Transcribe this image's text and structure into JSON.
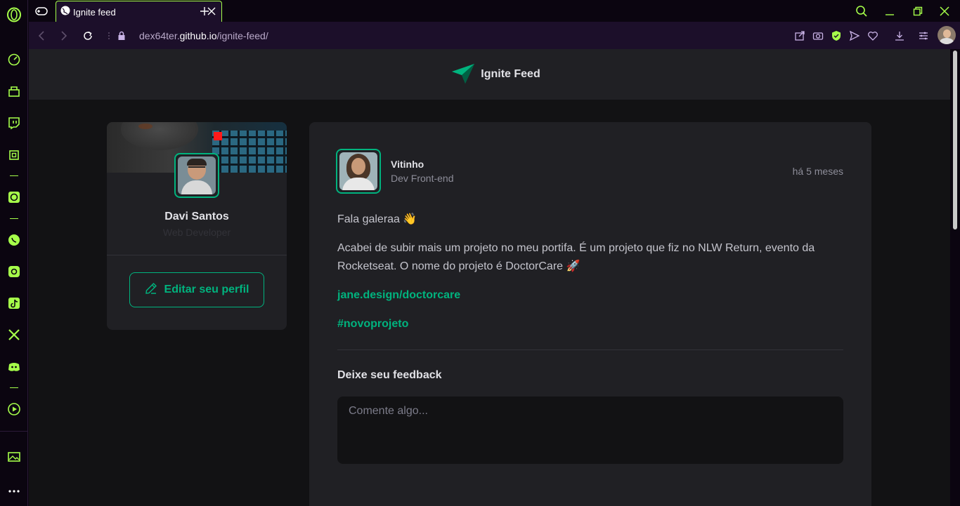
{
  "browser": {
    "tab_title": "Ignite feed",
    "url_prefix": "dex64ter.",
    "url_domain": "github.io",
    "url_path": "/ignite-feed/",
    "accent_color": "#a6ff4a"
  },
  "site": {
    "title": "Ignite Feed"
  },
  "profile": {
    "name": "Davi Santos",
    "role": "Web Developer",
    "edit_label": "Editar seu perfil"
  },
  "post": {
    "author_name": "Vitinho",
    "author_role": "Dev Front-end",
    "time": "há 5 meses",
    "greeting": "Fala galeraa 👋",
    "body": "Acabei de subir mais um projeto no meu portifa. É um projeto que fiz no NLW Return, evento da Rocketseat. O nome do projeto é DoctorCare 🚀",
    "link": "jane.design/doctorcare",
    "hashtag": "#novoprojeto",
    "feedback_title": "Deixe seu feedback",
    "comment_placeholder": "Comente algo..."
  },
  "colors": {
    "brand_green": "#00b37e",
    "background": "#121214",
    "card": "#202024"
  }
}
